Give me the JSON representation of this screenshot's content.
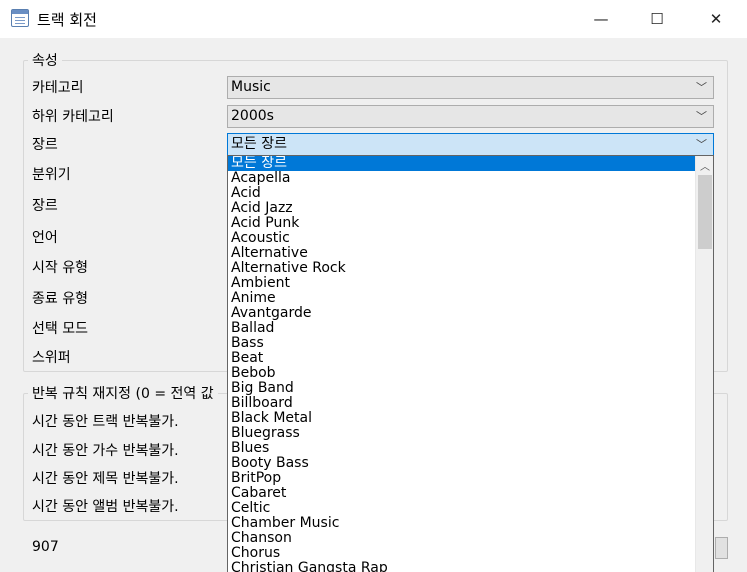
{
  "window": {
    "title": "트랙 회전",
    "minimize": "—",
    "maximize": "☐",
    "close": "✕"
  },
  "properties": {
    "title": "속성",
    "labels": [
      "카테고리",
      "하위 카테고리",
      "장르",
      "분위기",
      "장르",
      "언어",
      "시작 유형",
      "종료 유형",
      "선택 모드",
      "스위퍼"
    ],
    "category": "Music",
    "subcategory": "2000s",
    "genre": "모든 장르"
  },
  "dropdown": {
    "items": [
      "모든 장르",
      "Acapella",
      "Acid",
      "Acid Jazz",
      "Acid Punk",
      "Acoustic",
      "Alternative",
      "Alternative Rock",
      "Ambient",
      "Anime",
      "Avantgarde",
      "Ballad",
      "Bass",
      "Beat",
      "Bebob",
      "Big Band",
      "Billboard",
      "Black Metal",
      "Bluegrass",
      "Blues",
      "Booty Bass",
      "BritPop",
      "Cabaret",
      "Celtic",
      "Chamber Music",
      "Chanson",
      "Chorus",
      "Christian Gangsta Rap"
    ],
    "selected_index": 0
  },
  "repeat": {
    "title": "반복 규칙 재지정 (0 = 전역 값",
    "labels": [
      "시간 동안 트랙 반복불가.",
      "시간 동안 가수 반복불가.",
      "시간 동안 제목 반복불가.",
      "시간 동안 앨범 반복불가."
    ]
  },
  "footer": {
    "count": "907"
  }
}
